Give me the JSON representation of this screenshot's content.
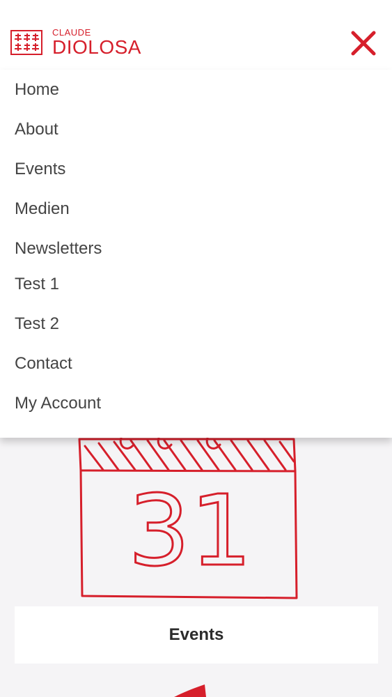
{
  "logo": {
    "small": "CLAUDE",
    "big": "DIOLOSA"
  },
  "nav": {
    "items": [
      {
        "label": "Home"
      },
      {
        "label": "About"
      },
      {
        "label": "Events"
      },
      {
        "label": "Medien"
      },
      {
        "label": "Newsletters"
      },
      {
        "label": "Test 1"
      },
      {
        "label": "Test 2"
      },
      {
        "label": "Contact"
      },
      {
        "label": "My Account"
      }
    ]
  },
  "calendar": {
    "day": "31"
  },
  "content": {
    "events_card_label": "Events"
  },
  "colors": {
    "accent": "#d61f2b",
    "status_green": "#3ccf5a",
    "text": "#444444",
    "background": "#f5f4f6"
  },
  "icons": {
    "close": "close-icon",
    "logo_seal": "seal-logo-icon",
    "status": "battery-icon"
  }
}
